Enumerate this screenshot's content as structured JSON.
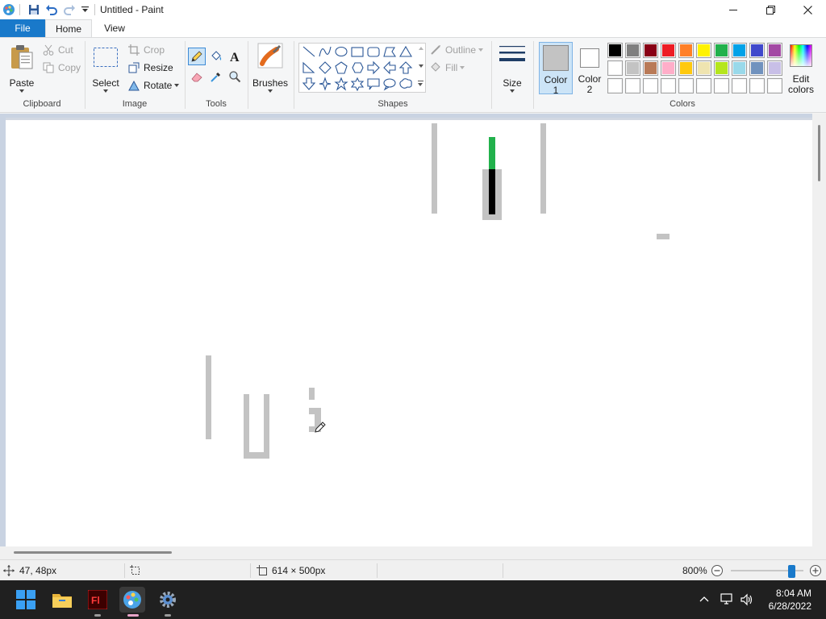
{
  "window": {
    "title": "Untitled - Paint"
  },
  "tabs": [
    {
      "label": "File"
    },
    {
      "label": "Home"
    },
    {
      "label": "View"
    }
  ],
  "ribbon": {
    "clipboard": {
      "group_label": "Clipboard",
      "paste": "Paste",
      "cut": "Cut",
      "copy": "Copy"
    },
    "image": {
      "group_label": "Image",
      "select": "Select",
      "crop": "Crop",
      "resize": "Resize",
      "rotate": "Rotate"
    },
    "tools": {
      "group_label": "Tools"
    },
    "brushes": {
      "label": "Brushes"
    },
    "shapes": {
      "group_label": "Shapes",
      "outline": "Outline",
      "fill": "Fill"
    },
    "size": {
      "label": "Size"
    },
    "color1": {
      "label_line1": "Color",
      "label_line2": "1",
      "value": "#c3c3c3"
    },
    "color2": {
      "label_line1": "Color",
      "label_line2": "2",
      "value": "#ffffff"
    },
    "colors": {
      "group_label": "Colors",
      "edit_line1": "Edit",
      "edit_line2": "colors"
    }
  },
  "palette": {
    "row1": [
      "#000000",
      "#7f7f7f",
      "#880015",
      "#ed1c24",
      "#ff7f27",
      "#fff200",
      "#22b14c",
      "#00a2e8",
      "#3f48cc",
      "#a349a4"
    ],
    "row2": [
      "#ffffff",
      "#c3c3c3",
      "#b97a57",
      "#ffaec9",
      "#ffc90e",
      "#efe4b0",
      "#b5e61d",
      "#99d9ea",
      "#7092be",
      "#c8bfe7"
    ],
    "row3": [
      "#ffffff",
      "#ffffff",
      "#ffffff",
      "#ffffff",
      "#ffffff",
      "#ffffff",
      "#ffffff",
      "#ffffff",
      "#ffffff",
      "#ffffff"
    ]
  },
  "status": {
    "cursor_pos": "47, 48px",
    "canvas_size": "614 × 500px",
    "zoom": "800%",
    "zoom_slider_fraction": 0.88
  },
  "clock": {
    "time": "8:04 AM",
    "date": "6/28/2022"
  }
}
